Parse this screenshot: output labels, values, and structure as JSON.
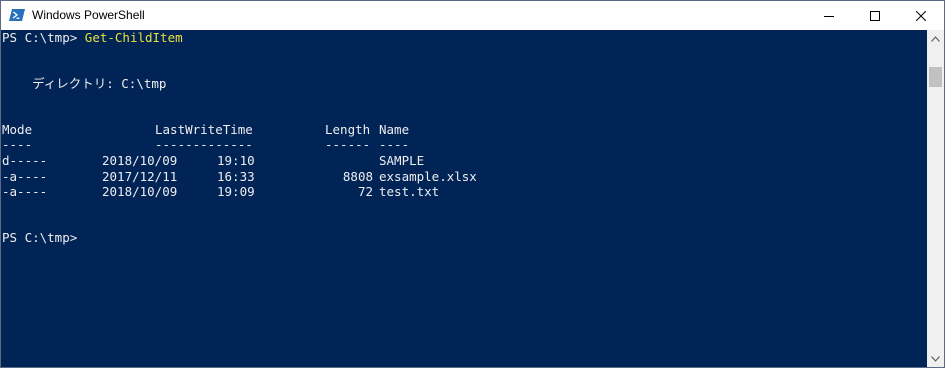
{
  "window": {
    "title": "Windows PowerShell",
    "app_icon": "powershell-icon",
    "controls": [
      "minimize-icon",
      "maximize-icon",
      "close-icon"
    ]
  },
  "console": {
    "prompt_1": "PS C:\\tmp> ",
    "command_1": "Get-ChildItem",
    "directory_line": "    ディレクトリ: C:\\tmp",
    "headers": {
      "mode": "Mode",
      "last_write_time": "LastWriteTime",
      "length": "Length",
      "name": "Name"
    },
    "separators": {
      "mode": "----",
      "last_write_time": "-------------",
      "length": "------",
      "name": "----"
    },
    "rows": [
      {
        "mode": "d-----",
        "date": "2018/10/09",
        "time": "19:10",
        "length": "",
        "name": "SAMPLE"
      },
      {
        "mode": "-a----",
        "date": "2017/12/11",
        "time": "16:33",
        "length": "8808",
        "name": "exsample.xlsx"
      },
      {
        "mode": "-a----",
        "date": "2018/10/09",
        "time": "19:09",
        "length": "72",
        "name": "test.txt"
      }
    ],
    "prompt_2": "PS C:\\tmp>"
  },
  "colors": {
    "background": "#012456",
    "text": "#eeedf0",
    "command": "#e7e03c"
  }
}
